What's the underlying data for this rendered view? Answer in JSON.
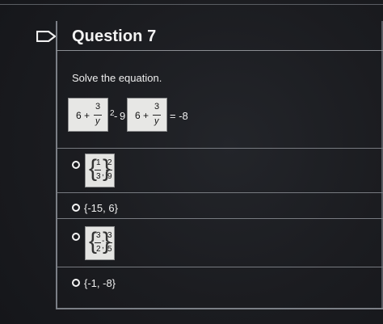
{
  "question": {
    "title": "Question 7",
    "prompt": "Solve the equation."
  },
  "equation": {
    "term1_whole": "6",
    "term1_plus": "+",
    "term1_frac_top": "3",
    "term1_frac_bottom": "y",
    "exponent": "2",
    "minus": "-",
    "coefficient": "9",
    "term2_whole": "6",
    "term2_plus": "+",
    "term2_frac_top": "3",
    "term2_frac_bottom": "y",
    "rhs": "= -8"
  },
  "choices": [
    {
      "label": "",
      "math": {
        "first_top": "1",
        "first_bottom": "3",
        "sep": ",",
        "second_top": "2",
        "second_bottom": "9"
      }
    },
    {
      "label": "{-15, 6}"
    },
    {
      "label": "",
      "math": {
        "first_top": "3",
        "first_bottom": "2",
        "sep": ",",
        "minus": "-",
        "second_top": "3",
        "second_bottom": "5"
      }
    },
    {
      "label": "{-1, -8}"
    }
  ],
  "icons": {
    "flag": "flag-icon",
    "radio": "radio-icon"
  },
  "colors": {
    "background": "#1a1c1f",
    "divider": "#777a80",
    "text": "#f0f0f0",
    "math_box": "#e6e6e4"
  }
}
